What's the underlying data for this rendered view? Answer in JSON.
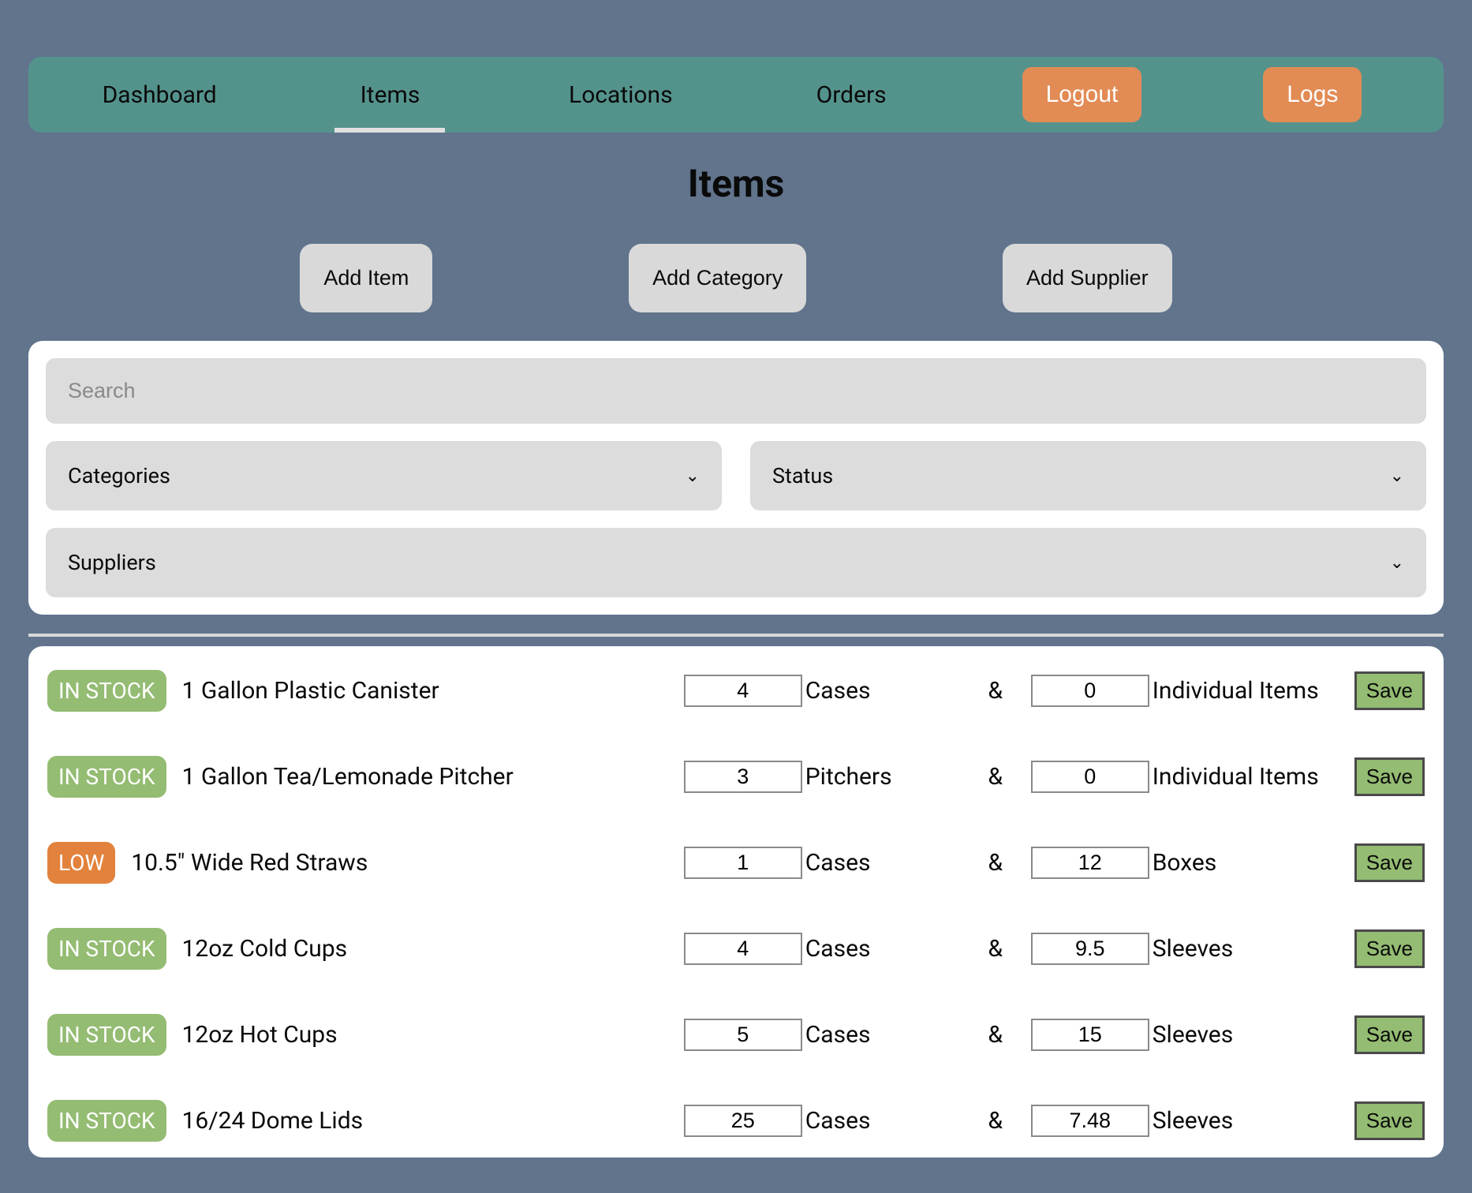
{
  "nav": {
    "items": [
      {
        "label": "Dashboard",
        "active": false
      },
      {
        "label": "Items",
        "active": true
      },
      {
        "label": "Locations",
        "active": false
      },
      {
        "label": "Orders",
        "active": false
      }
    ],
    "logout_label": "Logout",
    "logs_label": "Logs"
  },
  "page": {
    "title": "Items"
  },
  "actions": {
    "add_item": "Add Item",
    "add_category": "Add Category",
    "add_supplier": "Add Supplier"
  },
  "filters": {
    "search_placeholder": "Search",
    "categories_label": "Categories",
    "status_label": "Status",
    "suppliers_label": "Suppliers"
  },
  "common": {
    "ampersand": "&",
    "save_label": "Save"
  },
  "status_labels": {
    "in_stock": "IN STOCK",
    "low": "LOW"
  },
  "items": [
    {
      "status": "in_stock",
      "name": "1 Gallon Plastic Canister",
      "qty1": "4",
      "unit1": "Cases",
      "qty2": "0",
      "unit2": "Individual Items"
    },
    {
      "status": "in_stock",
      "name": "1 Gallon Tea/Lemonade Pitcher",
      "qty1": "3",
      "unit1": "Pitchers",
      "qty2": "0",
      "unit2": "Individual Items"
    },
    {
      "status": "low",
      "name": "10.5\" Wide Red Straws",
      "qty1": "1",
      "unit1": "Cases",
      "qty2": "12",
      "unit2": "Boxes"
    },
    {
      "status": "in_stock",
      "name": "12oz Cold Cups",
      "qty1": "4",
      "unit1": "Cases",
      "qty2": "9.5",
      "unit2": "Sleeves"
    },
    {
      "status": "in_stock",
      "name": "12oz Hot Cups",
      "qty1": "5",
      "unit1": "Cases",
      "qty2": "15",
      "unit2": "Sleeves"
    },
    {
      "status": "in_stock",
      "name": "16/24 Dome Lids",
      "qty1": "25",
      "unit1": "Cases",
      "qty2": "7.48",
      "unit2": "Sleeves"
    }
  ]
}
